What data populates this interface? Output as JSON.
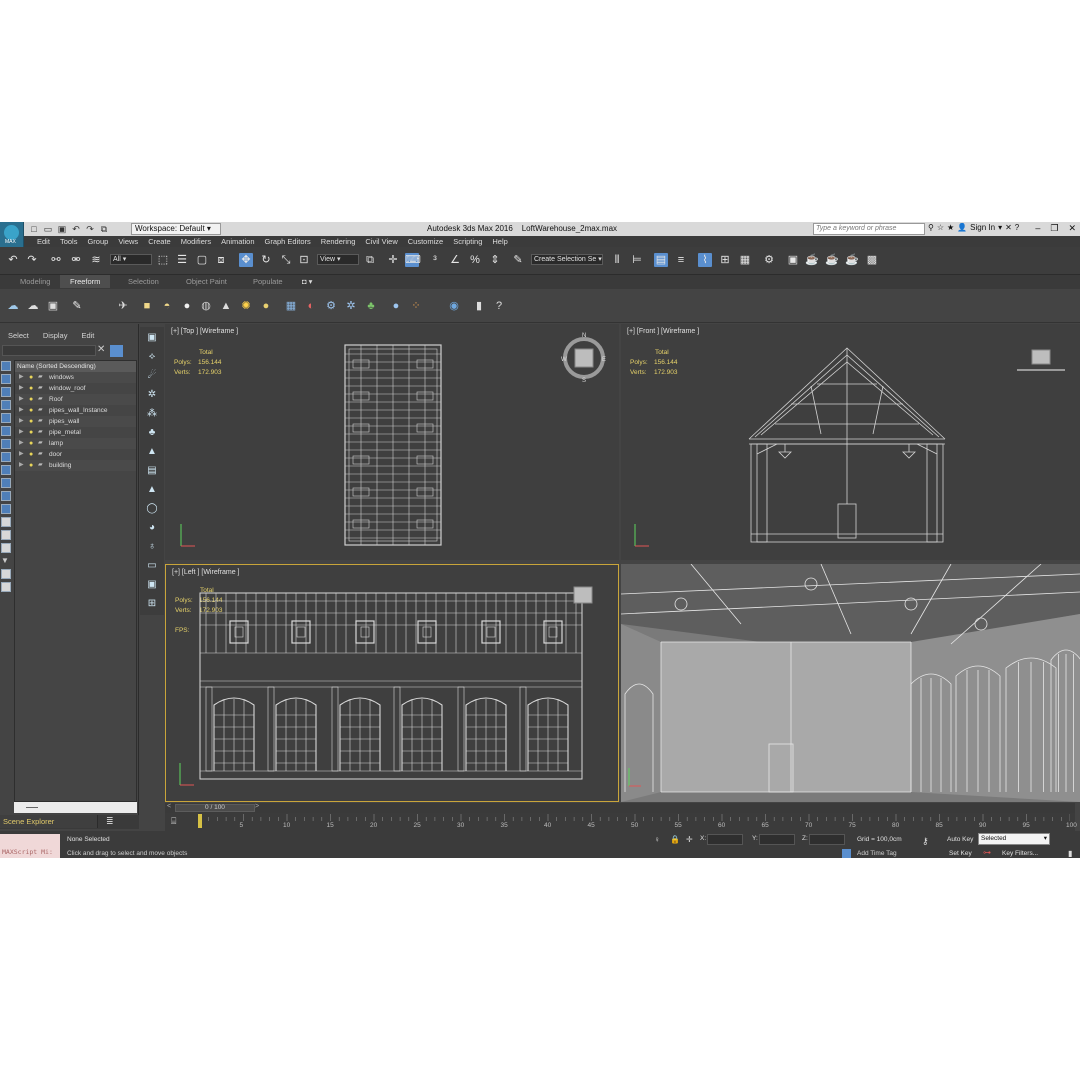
{
  "app": {
    "title": "Autodesk 3ds Max 2016",
    "filename": "LoftWarehouse_2max.max",
    "logo_label": "MAX",
    "workspace": "Workspace: Default",
    "search_placeholder": "Type a keyword or phrase",
    "sign_in": "Sign In"
  },
  "menu": [
    "Edit",
    "Tools",
    "Group",
    "Views",
    "Create",
    "Modifiers",
    "Animation",
    "Graph Editors",
    "Rendering",
    "Civil View",
    "Customize",
    "Scripting",
    "Help"
  ],
  "toolbar": {
    "filter": "All",
    "ref_coord": "View",
    "selection_set": "Create Selection Se"
  },
  "ribbon_tabs": [
    "Modeling",
    "Freeform",
    "Selection",
    "Object Paint",
    "Populate"
  ],
  "ribbon_active": "Freeform",
  "explorer": {
    "tabs": [
      "Select",
      "Display",
      "Edit"
    ],
    "header": "Name (Sorted Descending)",
    "items": [
      "windows",
      "window_roof",
      "Roof",
      "pipes_wall_Instance",
      "pipes_wall",
      "pipe_metal",
      "lamp",
      "door",
      "building"
    ],
    "footer": "Scene Explorer"
  },
  "viewports": {
    "top": {
      "label": "[+] [Top ] [Wireframe ]",
      "total": "Total",
      "polys_label": "Polys:",
      "polys": "156.144",
      "verts_label": "Verts:",
      "verts": "172.903",
      "compass": [
        "N",
        "W",
        "E",
        "S"
      ]
    },
    "front": {
      "label": "[+] [Front ] [Wireframe ]",
      "total": "Total",
      "polys_label": "Polys:",
      "polys": "156.144",
      "verts_label": "Verts:",
      "verts": "172.903"
    },
    "left": {
      "label": "[+] [Left ] [Wireframe ]",
      "total": "Total",
      "polys_label": "Polys:",
      "polys": "156.144",
      "verts_label": "Verts:",
      "verts": "172.903",
      "fps_label": "FPS:"
    }
  },
  "timeline": {
    "frame_range": "0 / 100",
    "ticks": [
      "5",
      "10",
      "15",
      "20",
      "25",
      "30",
      "35",
      "40",
      "45",
      "50",
      "55",
      "60",
      "65",
      "70",
      "75",
      "80",
      "85",
      "90",
      "95",
      "100"
    ]
  },
  "status": {
    "maxscript": "MAXScript Mi:",
    "selection": "None Selected",
    "hint": "Click and drag to select and move objects",
    "x_label": "X:",
    "y_label": "Y:",
    "z_label": "Z:",
    "grid": "Grid = 100,0cm",
    "add_time_tag": "Add Time Tag",
    "auto_key": "Auto Key",
    "selected": "Selected",
    "set_key": "Set Key",
    "key_filters": "Key Filters..."
  }
}
